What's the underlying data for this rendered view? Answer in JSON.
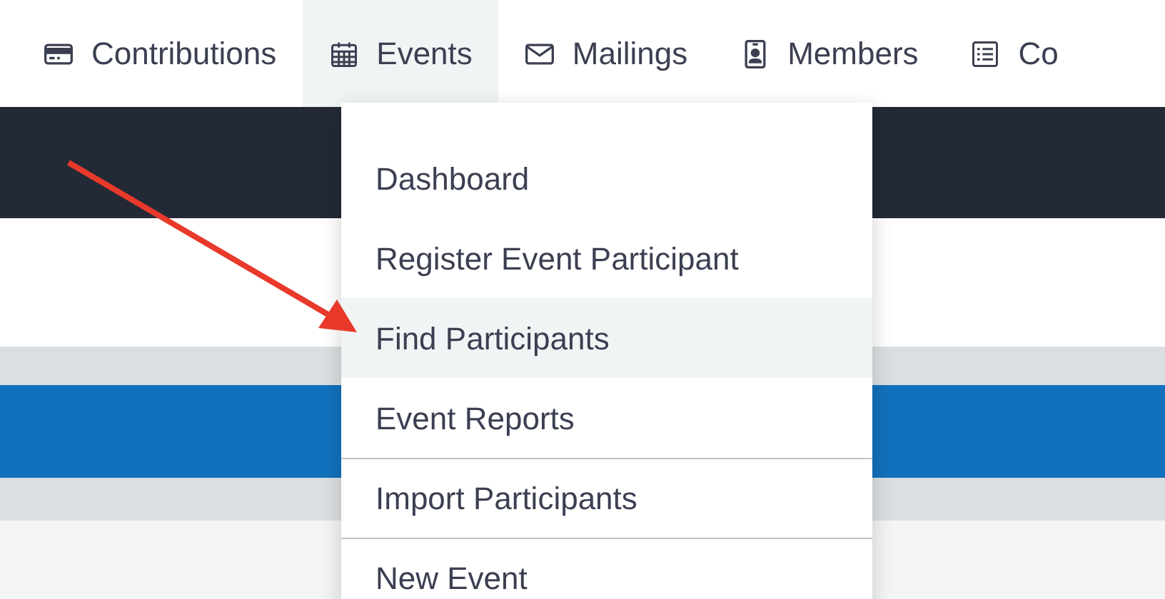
{
  "nav": [
    {
      "label": "Contributions",
      "selected": false
    },
    {
      "label": "Events",
      "selected": true
    },
    {
      "label": "Mailings",
      "selected": false
    },
    {
      "label": "Members",
      "selected": false
    },
    {
      "label": "Co",
      "selected": false
    }
  ],
  "menu": [
    {
      "label": "Dashboard",
      "selected": false,
      "separator_above": false
    },
    {
      "label": "Register Event Participant",
      "selected": false,
      "separator_above": false
    },
    {
      "label": "Find Participants",
      "selected": true,
      "separator_above": false
    },
    {
      "label": "Event Reports",
      "selected": false,
      "separator_above": false
    },
    {
      "label": "Import Participants",
      "selected": false,
      "separator_above": true
    },
    {
      "label": "New Event",
      "selected": false,
      "separator_above": true
    }
  ]
}
